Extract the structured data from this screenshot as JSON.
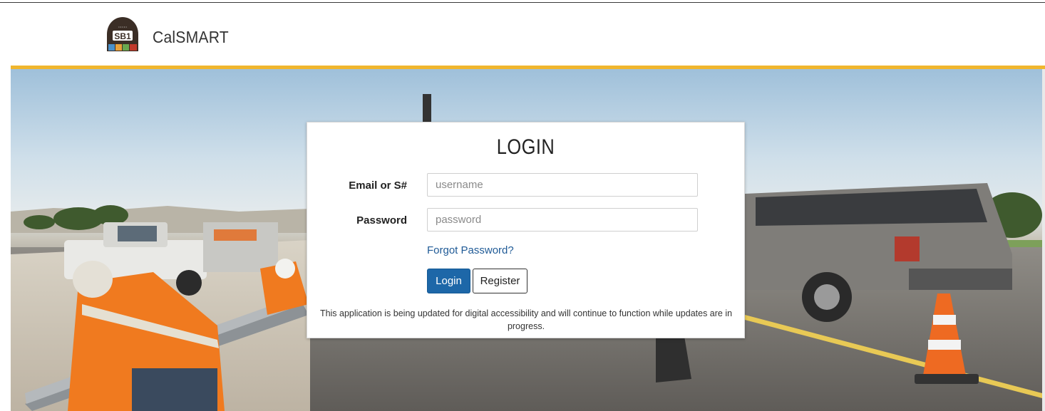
{
  "header": {
    "brand_name": "CalSMART",
    "logo_text": "SB1"
  },
  "login": {
    "title": "LOGIN",
    "email_label": "Email or S#",
    "email_placeholder": "username",
    "email_value": "",
    "password_label": "Password",
    "password_placeholder": "password",
    "password_value": "",
    "forgot_label": "Forgot Password?",
    "login_button": "Login",
    "register_button": "Register",
    "notice": "This application is being updated for digital accessibility and will continue to function while updates are in progress."
  },
  "colors": {
    "accent_bar": "#f0b62e",
    "primary_button": "#1d67a8",
    "link": "#1f5a96"
  }
}
